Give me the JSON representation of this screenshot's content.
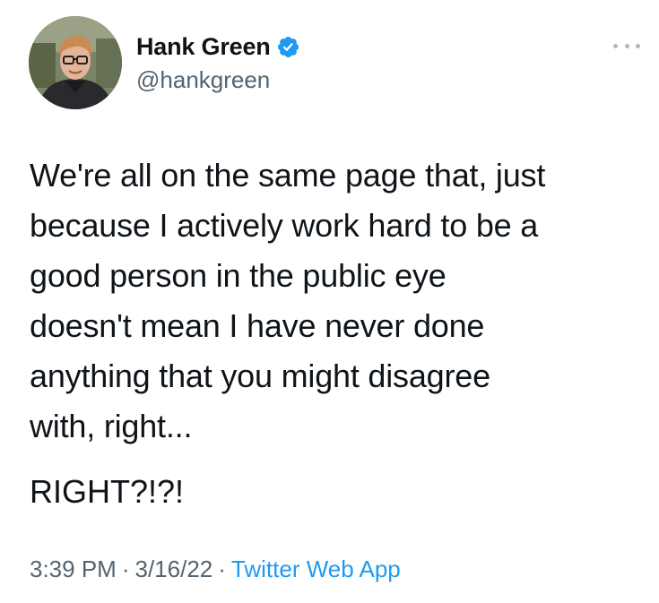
{
  "author": {
    "display_name": "Hank Green",
    "handle": "@hankgreen",
    "verified": true,
    "verified_color": "#1d9bf0"
  },
  "more_menu": {
    "icon": "more-horizontal-icon"
  },
  "tweet": {
    "text_lines": "We're all on the same page that, just\nbecause I actively work hard to be a\ngood person in the public eye\ndoesn't mean I have never done\nanything that you might disagree\nwith, right...",
    "text_second": "RIGHT?!?!"
  },
  "meta": {
    "time": "3:39 PM",
    "separator": "·",
    "date": "3/16/22",
    "source": "Twitter Web App"
  },
  "colors": {
    "text_primary": "#0f1419",
    "text_secondary": "#536471",
    "link": "#1d9bf0"
  }
}
